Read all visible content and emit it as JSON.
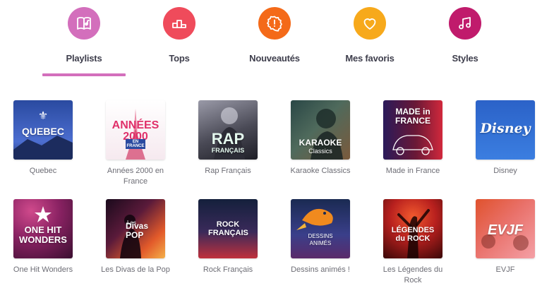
{
  "tabs": [
    {
      "label": "Playlists",
      "icon": "music-book-icon",
      "color": "#d36fbc",
      "active": true
    },
    {
      "label": "Tops",
      "icon": "podium-icon",
      "color": "#ef4b5b"
    },
    {
      "label": "Nouveautés",
      "icon": "new-badge-icon",
      "color": "#f46a19"
    },
    {
      "label": "Mes favoris",
      "icon": "heart-icon",
      "color": "#f7a91b"
    },
    {
      "label": "Styles",
      "icon": "music-note-icon",
      "color": "#c01b6c"
    }
  ],
  "playlists": [
    {
      "title": "Quebec",
      "cover_text": "QUEBEC",
      "colors": [
        "#2a4aa0",
        "#4c6ed0"
      ]
    },
    {
      "title": "Années 2000 en France",
      "cover_text": "ANNÉES 2000",
      "cover_sub": "EN FRANCE",
      "colors": [
        "#ffffff",
        "#f1dce6"
      ]
    },
    {
      "title": "Rap Français",
      "cover_text": "RAP",
      "cover_sub": "FRANÇAIS",
      "colors": [
        "#2b2b35",
        "#7a7a88"
      ]
    },
    {
      "title": "Karaoke Classics",
      "cover_text": "KARAOKE",
      "cover_sub": "Classics",
      "colors": [
        "#2a4746",
        "#7b5a3c"
      ]
    },
    {
      "title": "Made in France",
      "cover_text": "MADE in FRANCE",
      "colors": [
        "#4a1228",
        "#c0283c"
      ]
    },
    {
      "title": "Disney",
      "cover_text": "Disney",
      "colors": [
        "#2b62c8",
        "#3b7ee0"
      ]
    },
    {
      "title": "One Hit Wonders",
      "cover_text": "ONE HIT WONDERS",
      "colors": [
        "#5a1b4c",
        "#c23479"
      ]
    },
    {
      "title": "Les Divas de la Pop",
      "cover_text": "Divas POP",
      "cover_sub": "Les",
      "colors": [
        "#2b1028",
        "#e25a2a"
      ]
    },
    {
      "title": "Rock Français",
      "cover_text": "ROCK FRANÇAIS",
      "colors": [
        "#14203c",
        "#c0303c"
      ]
    },
    {
      "title": "Dessins animés !",
      "cover_text": "DESSINS ANIMÉS",
      "colors": [
        "#19284a",
        "#3a3f8a"
      ]
    },
    {
      "title": "Les Légendes du Rock",
      "cover_text": "LÉGENDES du ROCK",
      "colors": [
        "#4a0f10",
        "#d2301e"
      ]
    },
    {
      "title": "EVJF",
      "cover_text": "EVJF",
      "colors": [
        "#e0522d",
        "#f4a0a6"
      ]
    }
  ]
}
